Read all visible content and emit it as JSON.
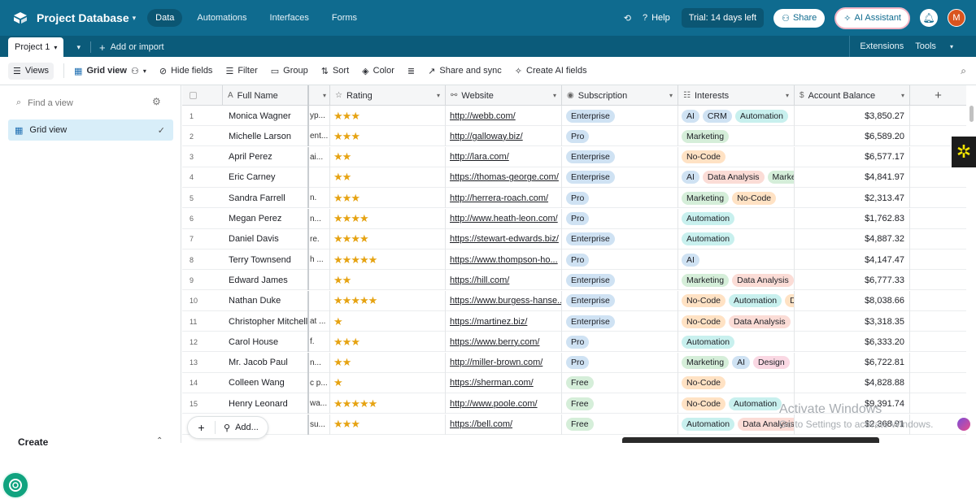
{
  "app": {
    "base_title": "Project Database",
    "nav_tabs": [
      "Data",
      "Automations",
      "Interfaces",
      "Forms"
    ],
    "help": "Help",
    "trial": "Trial: 14 days left",
    "share": "Share",
    "ai_assistant": "AI Assistant",
    "avatar_initial": "M"
  },
  "tablebar": {
    "table_name": "Project 1",
    "add_import": "Add or import",
    "extensions": "Extensions",
    "tools": "Tools"
  },
  "viewbar": {
    "views": "Views",
    "grid_view": "Grid view",
    "hide_fields": "Hide fields",
    "filter": "Filter",
    "group": "Group",
    "sort": "Sort",
    "color": "Color",
    "share_sync": "Share and sync",
    "create_ai_fields": "Create AI fields"
  },
  "sidebar": {
    "find_placeholder": "Find a view",
    "views": [
      {
        "label": "Grid view",
        "selected": true
      }
    ],
    "create": "Create"
  },
  "grid": {
    "columns": [
      "Full Name",
      "Rating",
      "Website",
      "Subscription",
      "Interests",
      "Account Balance"
    ],
    "rows": [
      {
        "n": "1",
        "name": "Monica Wagner",
        "cut": "yp...",
        "rating": 3,
        "website": "http://webb.com/",
        "sub": "Enterprise",
        "interests": [
          "AI",
          "CRM",
          "Automation"
        ],
        "balance": "$3,850.27"
      },
      {
        "n": "2",
        "name": "Michelle Larson",
        "cut": "ent...",
        "rating": 3,
        "website": "http://galloway.biz/",
        "sub": "Pro",
        "interests": [
          "Marketing"
        ],
        "balance": "$6,589.20"
      },
      {
        "n": "3",
        "name": "April Perez",
        "cut": "ai...",
        "rating": 2,
        "website": "http://lara.com/",
        "sub": "Enterprise",
        "interests": [
          "No-Code"
        ],
        "balance": "$6,577.17"
      },
      {
        "n": "4",
        "name": "Eric Carney",
        "cut": "",
        "rating": 2,
        "website": "https://thomas-george.com/",
        "sub": "Enterprise",
        "interests": [
          "AI",
          "Data Analysis",
          "Market"
        ],
        "balance": "$4,841.97"
      },
      {
        "n": "5",
        "name": "Sandra Farrell",
        "cut": "n.",
        "rating": 3,
        "website": "http://herrera-roach.com/",
        "sub": "Pro",
        "interests": [
          "Marketing",
          "No-Code"
        ],
        "balance": "$2,313.47"
      },
      {
        "n": "6",
        "name": "Megan Perez",
        "cut": "n...",
        "rating": 4,
        "website": "http://www.heath-leon.com/",
        "sub": "Pro",
        "interests": [
          "Automation"
        ],
        "balance": "$1,762.83"
      },
      {
        "n": "7",
        "name": "Daniel Davis",
        "cut": "re.",
        "rating": 4,
        "website": "https://stewart-edwards.biz/",
        "sub": "Enterprise",
        "interests": [
          "Automation"
        ],
        "balance": "$4,887.32"
      },
      {
        "n": "8",
        "name": "Terry Townsend",
        "cut": "h ...",
        "rating": 5,
        "website": "https://www.thompson-ho...",
        "sub": "Pro",
        "interests": [
          "AI"
        ],
        "balance": "$4,147.47"
      },
      {
        "n": "9",
        "name": "Edward James",
        "cut": "",
        "rating": 2,
        "website": "https://hill.com/",
        "sub": "Enterprise",
        "interests": [
          "Marketing",
          "Data Analysis"
        ],
        "balance": "$6,777.33"
      },
      {
        "n": "10",
        "name": "Nathan Duke",
        "cut": "",
        "rating": 5,
        "website": "https://www.burgess-hanse...",
        "sub": "Enterprise",
        "interests": [
          "No-Code",
          "Automation",
          "D"
        ],
        "balance": "$8,038.66"
      },
      {
        "n": "11",
        "name": "Christopher Mitchell",
        "cut": "at ...",
        "rating": 1,
        "website": "https://martinez.biz/",
        "sub": "Enterprise",
        "interests": [
          "No-Code",
          "Data Analysis"
        ],
        "balance": "$3,318.35"
      },
      {
        "n": "12",
        "name": "Carol House",
        "cut": "f.",
        "rating": 3,
        "website": "https://www.berry.com/",
        "sub": "Pro",
        "interests": [
          "Automation"
        ],
        "balance": "$6,333.20"
      },
      {
        "n": "13",
        "name": "Mr. Jacob Paul",
        "cut": "n...",
        "rating": 2,
        "website": "http://miller-brown.com/",
        "sub": "Pro",
        "interests": [
          "Marketing",
          "AI",
          "Design"
        ],
        "balance": "$6,722.81"
      },
      {
        "n": "14",
        "name": "Colleen Wang",
        "cut": "c p...",
        "rating": 1,
        "website": "https://sherman.com/",
        "sub": "Free",
        "interests": [
          "No-Code"
        ],
        "balance": "$4,828.88"
      },
      {
        "n": "15",
        "name": "Henry Leonard",
        "cut": "wa...",
        "rating": 5,
        "website": "http://www.poole.com/",
        "sub": "Free",
        "interests": [
          "No-Code",
          "Automation"
        ],
        "balance": "$9,391.74"
      },
      {
        "n": "16",
        "name": "on",
        "cut": "su...",
        "rating": 3,
        "website": "https://bell.com/",
        "sub": "Free",
        "interests": [
          "Automation",
          "Data Analysis"
        ],
        "balance": "$2,368.91"
      }
    ],
    "add_label": "Add...",
    "colors": {
      "Enterprise": "#cfe2f3",
      "Pro": "#cfe2f3",
      "Free": "#d5eed9",
      "AI": "#cfe2f3",
      "CRM": "#cfe2f3",
      "Automation": "#c8f0ee",
      "Marketing": "#d5eed9",
      "No-Code": "#ffe2c4",
      "Data Analysis": "#fbdcd6",
      "Market": "#d5eed9",
      "D": "#ffe2c4",
      "Design": "#fad8e3"
    }
  },
  "overlay": {
    "activate_title": "Activate Windows",
    "activate_sub": "Go to Settings to activate Windows."
  }
}
